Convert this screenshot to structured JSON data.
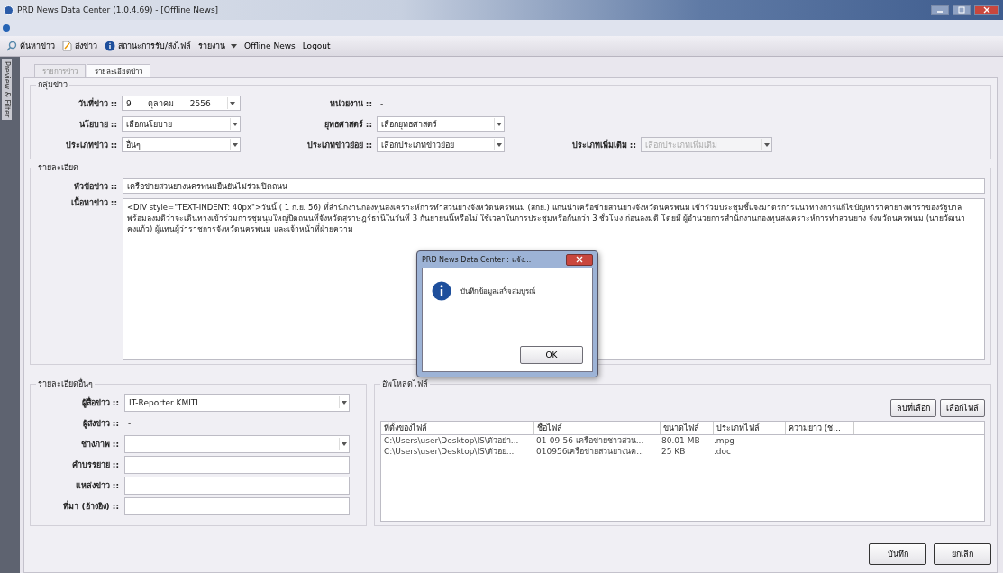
{
  "window": {
    "title": "PRD News Data Center (1.0.4.69) - [Offline News]"
  },
  "menu": [
    {
      "label": "ค้นหาข่าว",
      "kind": "search"
    },
    {
      "label": "ส่งข่าว",
      "kind": "document"
    },
    {
      "label": "สถานะการรับ/ส่งไฟล์",
      "kind": "info"
    },
    {
      "label": "รายงาน",
      "kind": "dropdown"
    },
    {
      "label": "Offline News",
      "kind": "plain"
    },
    {
      "label": "Logout",
      "kind": "plain"
    }
  ],
  "side_tab": "Preview & Filter",
  "tabs": [
    {
      "label": "รายการข่าว",
      "selected": false
    },
    {
      "label": "รายละเอียดข่าว",
      "selected": true
    }
  ],
  "news_group": {
    "title": "กลุ่มข่าว",
    "rows": [
      [
        {
          "label": "วันที่ข่าว ::",
          "kind": "date",
          "day": "9",
          "month": "ตุลาคม",
          "year": "2556"
        },
        {
          "label": "หน่วยงาน ::",
          "kind": "static",
          "value": "-"
        }
      ],
      [
        {
          "label": "นโยบาย ::",
          "kind": "select",
          "value": "เลือกนโยบาย",
          "disabled": false
        },
        {
          "label": "ยุทธศาสตร์ ::",
          "kind": "select",
          "value": "เลือกยุทธศาสตร์",
          "disabled": false
        }
      ],
      [
        {
          "label": "ประเภทข่าว ::",
          "kind": "select",
          "value": "อื่นๆ",
          "disabled": false
        },
        {
          "label": "ประเภทข่าวย่อย ::",
          "kind": "select",
          "value": "เลือกประเภทข่าวย่อย",
          "disabled": false
        },
        {
          "label": "ประเภทเพิ่มเติม ::",
          "kind": "select",
          "value": "เลือกประเภทเพิ่มเติม",
          "disabled": true
        }
      ]
    ]
  },
  "detail_group": {
    "title": "รายละเอียด",
    "headline_label": "หัวข้อข่าว ::",
    "headline": "เครือข่ายสวนยางนครพนมยืนยันไม่ร่วมปิดถนน",
    "content_label": "เนื้อหาข่าว ::",
    "content": "<DIV style=\"TEXT-INDENT: 40px\">วันนี้ ( 1 ก.ย. 56)  ที่สำนักงานกองทุนสงเคราะห์การทำสวนยางจังหวัดนครพนม (สกย.) แกนนำเครือข่ายสวนยางจังหวัดนครพนม เข้าร่วมประชุมชี้แจงมาตรการแนวทางการแก้ไขปัญหาราคายางพาราของรัฐบาล พร้อมลงมติว่าจะเดินทางเข้าร่วมการชุมนุมใหญ่ปิดถนนที่จังหวัดสุราษฎร์ธานีในวันที่ 3 กันยายนนี้หรือไม่ ใช้เวลาในการประชุมหรือกันกว่า 3 ชั่วโมง ก่อนลงมติ โดยมี ผู้อำนวยการสำนักงานกองทุนสงเคราะห์การทำสวนยาง จังหวัดนครพนม (นายวัฒนา คงแก้ว) ผู้แทนผู้ว่าราชการจังหวัดนครพนม และเจ้าหน้าที่ฝ่ายความ"
  },
  "other_group": {
    "title": "รายละเอียดอื่นๆ",
    "fields": [
      {
        "label": "ผู้สื่อข่าว ::",
        "kind": "select",
        "value": "IT-Reporter KMITL"
      },
      {
        "label": "ผู้ส่งข่าว ::",
        "kind": "static",
        "value": "-"
      },
      {
        "label": "ช่างภาพ ::",
        "kind": "select"
      },
      {
        "label": "คำบรรยาย ::",
        "kind": "text"
      },
      {
        "label": "แหล่งข่าว ::",
        "kind": "text"
      },
      {
        "label": "ที่มา (อ้างอิง) ::",
        "kind": "text"
      }
    ]
  },
  "upload_group": {
    "title": "อัพโหลดไฟล์",
    "buttons": [
      "ลบที่เลือก",
      "เลือกไฟล์"
    ],
    "columns": [
      "ที่ตั้งของไฟล์",
      "ชื่อไฟล์",
      "ขนาดไฟล์",
      "ประเภทไฟล์",
      "ความยาว (ช..."
    ],
    "rows": [
      [
        "C:\\Users\\user\\Desktop\\IS\\ตัวอย่า...",
        "01-09-56 เครือข่ายชาวสวน...",
        "80.01 MB",
        ".mpg"
      ],
      [
        "C:\\Users\\user\\Desktop\\IS\\ตัวอย...",
        "010956เครือข่ายสวนยางนค...",
        "25 KB",
        ".doc"
      ]
    ]
  },
  "actions": [
    "บันทึก",
    "ยกเลิก"
  ],
  "dialog": {
    "title": "PRD News Data Center : แจ้ง...",
    "message": "บันทึกข้อมูลเสร็จสมบูรณ์",
    "button": "OK"
  }
}
